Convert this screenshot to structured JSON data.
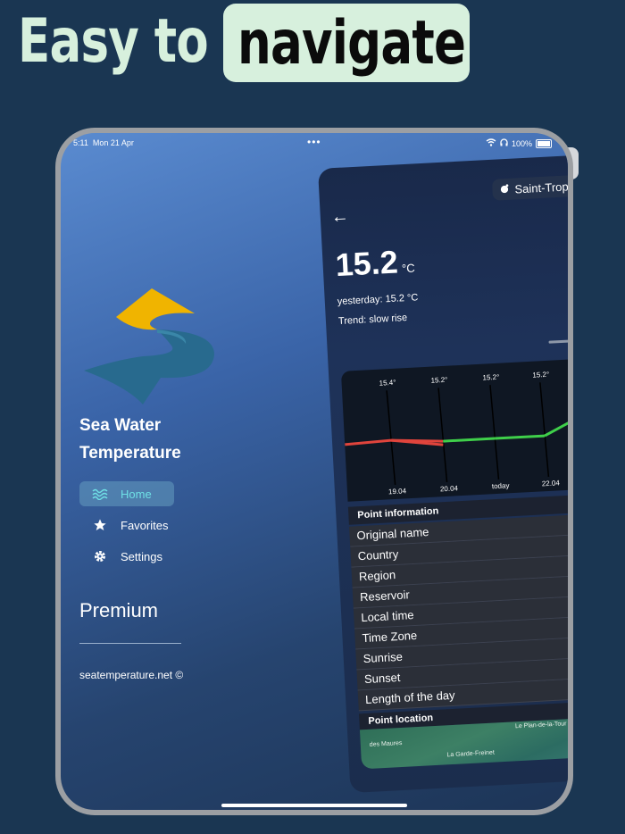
{
  "headline": {
    "plain": "Easy to",
    "highlight": "navigate"
  },
  "statusbar": {
    "time": "5:11",
    "date": "Mon 21 Apr",
    "battery": "100%"
  },
  "app": {
    "title_line1": "Sea Water",
    "title_line2": "Temperature"
  },
  "nav": {
    "items": [
      {
        "label": "Home",
        "icon": "waves-icon",
        "active": true
      },
      {
        "label": "Favorites",
        "icon": "star-icon",
        "active": false
      },
      {
        "label": "Settings",
        "icon": "gear-icon",
        "active": false
      }
    ]
  },
  "premium": "Premium",
  "website": "seatemperature.net ©",
  "panel": {
    "location": "Saint-Trope",
    "temperature": "15.2",
    "unit": "°C",
    "yesterday": "yesterday: 15.2  °C",
    "trend": "Trend: slow rise"
  },
  "chart_data": {
    "type": "line",
    "categories": [
      "19.04",
      "20.04",
      "today",
      "22.04"
    ],
    "values": [
      15.4,
      15.2,
      15.2,
      15.2
    ],
    "value_labels": [
      "15.4°",
      "15.2°",
      "15.2°",
      "15.2°"
    ],
    "colors": {
      "falling": "#e0443c",
      "rising": "#3fcf4a"
    }
  },
  "info": {
    "header": "Point information",
    "rows": [
      "Original name",
      "Country",
      "Region",
      "Reservoir",
      "Local time",
      "Time Zone",
      "Sunrise",
      "Sunset",
      "Length of the day"
    ]
  },
  "location": {
    "header": "Point location",
    "map_labels": [
      "Le Plan-de-la-Tour",
      "des Maures",
      "La Garde-Freinet"
    ]
  },
  "colors": {
    "background": "#1a3652",
    "headline": "#d7f0dd",
    "accent": "#6fe0e6"
  }
}
